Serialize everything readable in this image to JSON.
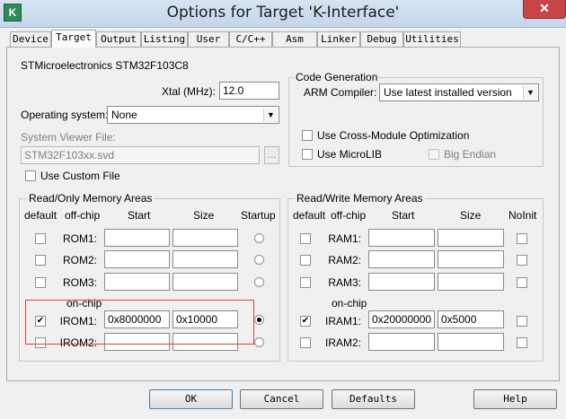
{
  "window": {
    "title": "Options for Target 'K-Interface'",
    "close_glyph": "✕",
    "app_icon_glyph": "K"
  },
  "tabs": [
    "Device",
    "Target",
    "Output",
    "Listing",
    "User",
    "C/C++",
    "Asm",
    "Linker",
    "Debug",
    "Utilities"
  ],
  "device": {
    "name": "STMicroelectronics STM32F103C8",
    "xtal_label": "Xtal (MHz):",
    "xtal_value": "12.0",
    "os_label": "Operating system:",
    "os_value": "None",
    "svf_label": "System Viewer File:",
    "svf_value": "STM32F103xx.svd",
    "svf_browse": "...",
    "custom_file_label": "Use Custom File"
  },
  "code_generation": {
    "title": "Code Generation",
    "compiler_label": "ARM Compiler:",
    "compiler_value": "Use latest installed version",
    "cross_module": "Use Cross-Module Optimization",
    "microlib": "Use MicroLIB",
    "big_endian": "Big Endian"
  },
  "rom": {
    "title": "Read/Only Memory Areas",
    "headers": {
      "default": "default",
      "offchip": "off-chip",
      "start": "Start",
      "size": "Size",
      "startup": "Startup"
    },
    "onchip_label": "on-chip",
    "rows": [
      {
        "label": "ROM1:",
        "start": "",
        "size": ""
      },
      {
        "label": "ROM2:",
        "start": "",
        "size": ""
      },
      {
        "label": "ROM3:",
        "start": "",
        "size": ""
      },
      {
        "label": "IROM1:",
        "start": "0x8000000",
        "size": "0x10000"
      },
      {
        "label": "IROM2:",
        "start": "",
        "size": ""
      }
    ]
  },
  "ram": {
    "title": "Read/Write Memory Areas",
    "headers": {
      "default": "default",
      "offchip": "off-chip",
      "start": "Start",
      "size": "Size",
      "noinit": "NoInit"
    },
    "onchip_label": "on-chip",
    "rows": [
      {
        "label": "RAM1:",
        "start": "",
        "size": ""
      },
      {
        "label": "RAM2:",
        "start": "",
        "size": ""
      },
      {
        "label": "RAM3:",
        "start": "",
        "size": ""
      },
      {
        "label": "IRAM1:",
        "start": "0x20000000",
        "size": "0x5000"
      },
      {
        "label": "IRAM2:",
        "start": "",
        "size": ""
      }
    ]
  },
  "buttons": {
    "ok": "OK",
    "cancel": "Cancel",
    "defaults": "Defaults",
    "help": "Help"
  },
  "check_glyph": "✔",
  "dropdown_glyph": "▼"
}
